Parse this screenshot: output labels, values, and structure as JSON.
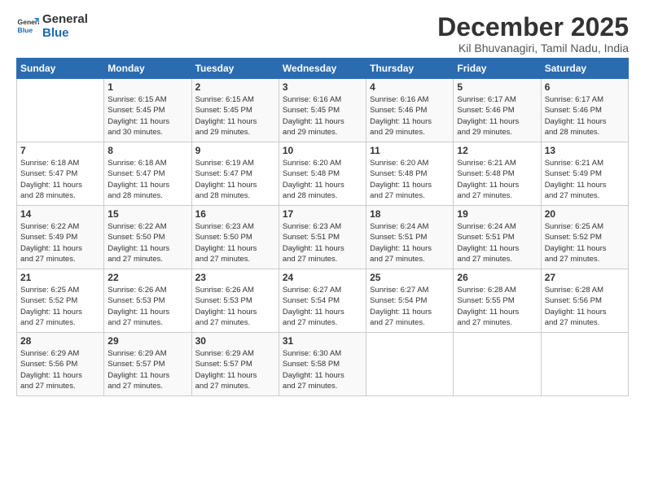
{
  "logo": {
    "line1": "General",
    "line2": "Blue"
  },
  "title": "December 2025",
  "subtitle": "Kil Bhuvanagiri, Tamil Nadu, India",
  "header": {
    "days": [
      "Sunday",
      "Monday",
      "Tuesday",
      "Wednesday",
      "Thursday",
      "Friday",
      "Saturday"
    ]
  },
  "weeks": [
    [
      {
        "day": "",
        "info": ""
      },
      {
        "day": "1",
        "info": "Sunrise: 6:15 AM\nSunset: 5:45 PM\nDaylight: 11 hours\nand 30 minutes."
      },
      {
        "day": "2",
        "info": "Sunrise: 6:15 AM\nSunset: 5:45 PM\nDaylight: 11 hours\nand 29 minutes."
      },
      {
        "day": "3",
        "info": "Sunrise: 6:16 AM\nSunset: 5:45 PM\nDaylight: 11 hours\nand 29 minutes."
      },
      {
        "day": "4",
        "info": "Sunrise: 6:16 AM\nSunset: 5:46 PM\nDaylight: 11 hours\nand 29 minutes."
      },
      {
        "day": "5",
        "info": "Sunrise: 6:17 AM\nSunset: 5:46 PM\nDaylight: 11 hours\nand 29 minutes."
      },
      {
        "day": "6",
        "info": "Sunrise: 6:17 AM\nSunset: 5:46 PM\nDaylight: 11 hours\nand 28 minutes."
      }
    ],
    [
      {
        "day": "7",
        "info": "Sunrise: 6:18 AM\nSunset: 5:47 PM\nDaylight: 11 hours\nand 28 minutes."
      },
      {
        "day": "8",
        "info": "Sunrise: 6:18 AM\nSunset: 5:47 PM\nDaylight: 11 hours\nand 28 minutes."
      },
      {
        "day": "9",
        "info": "Sunrise: 6:19 AM\nSunset: 5:47 PM\nDaylight: 11 hours\nand 28 minutes."
      },
      {
        "day": "10",
        "info": "Sunrise: 6:20 AM\nSunset: 5:48 PM\nDaylight: 11 hours\nand 28 minutes."
      },
      {
        "day": "11",
        "info": "Sunrise: 6:20 AM\nSunset: 5:48 PM\nDaylight: 11 hours\nand 27 minutes."
      },
      {
        "day": "12",
        "info": "Sunrise: 6:21 AM\nSunset: 5:48 PM\nDaylight: 11 hours\nand 27 minutes."
      },
      {
        "day": "13",
        "info": "Sunrise: 6:21 AM\nSunset: 5:49 PM\nDaylight: 11 hours\nand 27 minutes."
      }
    ],
    [
      {
        "day": "14",
        "info": "Sunrise: 6:22 AM\nSunset: 5:49 PM\nDaylight: 11 hours\nand 27 minutes."
      },
      {
        "day": "15",
        "info": "Sunrise: 6:22 AM\nSunset: 5:50 PM\nDaylight: 11 hours\nand 27 minutes."
      },
      {
        "day": "16",
        "info": "Sunrise: 6:23 AM\nSunset: 5:50 PM\nDaylight: 11 hours\nand 27 minutes."
      },
      {
        "day": "17",
        "info": "Sunrise: 6:23 AM\nSunset: 5:51 PM\nDaylight: 11 hours\nand 27 minutes."
      },
      {
        "day": "18",
        "info": "Sunrise: 6:24 AM\nSunset: 5:51 PM\nDaylight: 11 hours\nand 27 minutes."
      },
      {
        "day": "19",
        "info": "Sunrise: 6:24 AM\nSunset: 5:51 PM\nDaylight: 11 hours\nand 27 minutes."
      },
      {
        "day": "20",
        "info": "Sunrise: 6:25 AM\nSunset: 5:52 PM\nDaylight: 11 hours\nand 27 minutes."
      }
    ],
    [
      {
        "day": "21",
        "info": "Sunrise: 6:25 AM\nSunset: 5:52 PM\nDaylight: 11 hours\nand 27 minutes."
      },
      {
        "day": "22",
        "info": "Sunrise: 6:26 AM\nSunset: 5:53 PM\nDaylight: 11 hours\nand 27 minutes."
      },
      {
        "day": "23",
        "info": "Sunrise: 6:26 AM\nSunset: 5:53 PM\nDaylight: 11 hours\nand 27 minutes."
      },
      {
        "day": "24",
        "info": "Sunrise: 6:27 AM\nSunset: 5:54 PM\nDaylight: 11 hours\nand 27 minutes."
      },
      {
        "day": "25",
        "info": "Sunrise: 6:27 AM\nSunset: 5:54 PM\nDaylight: 11 hours\nand 27 minutes."
      },
      {
        "day": "26",
        "info": "Sunrise: 6:28 AM\nSunset: 5:55 PM\nDaylight: 11 hours\nand 27 minutes."
      },
      {
        "day": "27",
        "info": "Sunrise: 6:28 AM\nSunset: 5:56 PM\nDaylight: 11 hours\nand 27 minutes."
      }
    ],
    [
      {
        "day": "28",
        "info": "Sunrise: 6:29 AM\nSunset: 5:56 PM\nDaylight: 11 hours\nand 27 minutes."
      },
      {
        "day": "29",
        "info": "Sunrise: 6:29 AM\nSunset: 5:57 PM\nDaylight: 11 hours\nand 27 minutes."
      },
      {
        "day": "30",
        "info": "Sunrise: 6:29 AM\nSunset: 5:57 PM\nDaylight: 11 hours\nand 27 minutes."
      },
      {
        "day": "31",
        "info": "Sunrise: 6:30 AM\nSunset: 5:58 PM\nDaylight: 11 hours\nand 27 minutes."
      },
      {
        "day": "",
        "info": ""
      },
      {
        "day": "",
        "info": ""
      },
      {
        "day": "",
        "info": ""
      }
    ]
  ]
}
